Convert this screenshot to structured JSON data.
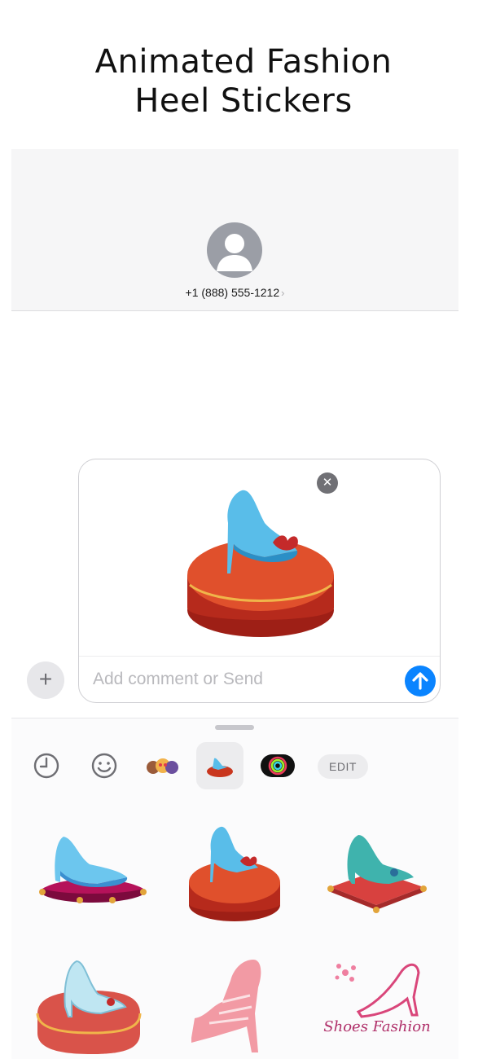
{
  "headline": {
    "line1": "Animated Fashion",
    "line2": "Heel Stickers"
  },
  "contact": {
    "number": "+1 (888) 555-1212",
    "chevron": "›",
    "avatar_icon": "person-avatar-icon"
  },
  "compose": {
    "placeholder": "Add comment or Send",
    "remove_glyph": "✕",
    "plus_glyph": "+",
    "attached_sticker": "heel-on-red-pouf-sticker"
  },
  "drawer": {
    "tray": [
      {
        "name": "recents-icon",
        "selected": false
      },
      {
        "name": "emoji-icon",
        "selected": false
      },
      {
        "name": "memoji-icon",
        "selected": false
      },
      {
        "name": "heel-sticker-pack-icon",
        "selected": true
      },
      {
        "name": "activity-rings-icon",
        "selected": false
      }
    ],
    "edit_label": "EDIT"
  },
  "stickers": [
    {
      "name": "blue-heel-magenta-cushion-sticker"
    },
    {
      "name": "blue-heel-red-pouf-sticker"
    },
    {
      "name": "teal-heel-red-cushion-sticker"
    },
    {
      "name": "glass-heel-red-pillow-sticker"
    },
    {
      "name": "pink-strappy-heel-sticker"
    },
    {
      "name": "shoes-fashion-logo-sticker",
      "caption": "Shoes Fashion"
    }
  ],
  "colors": {
    "send_blue": "#0a84ff",
    "header_bg": "#f6f6f7",
    "pouf_red": "#c9361e",
    "heel_blue": "#59bde9",
    "heel_teal": "#3fb3ad",
    "heel_pink": "#f29aa4"
  }
}
